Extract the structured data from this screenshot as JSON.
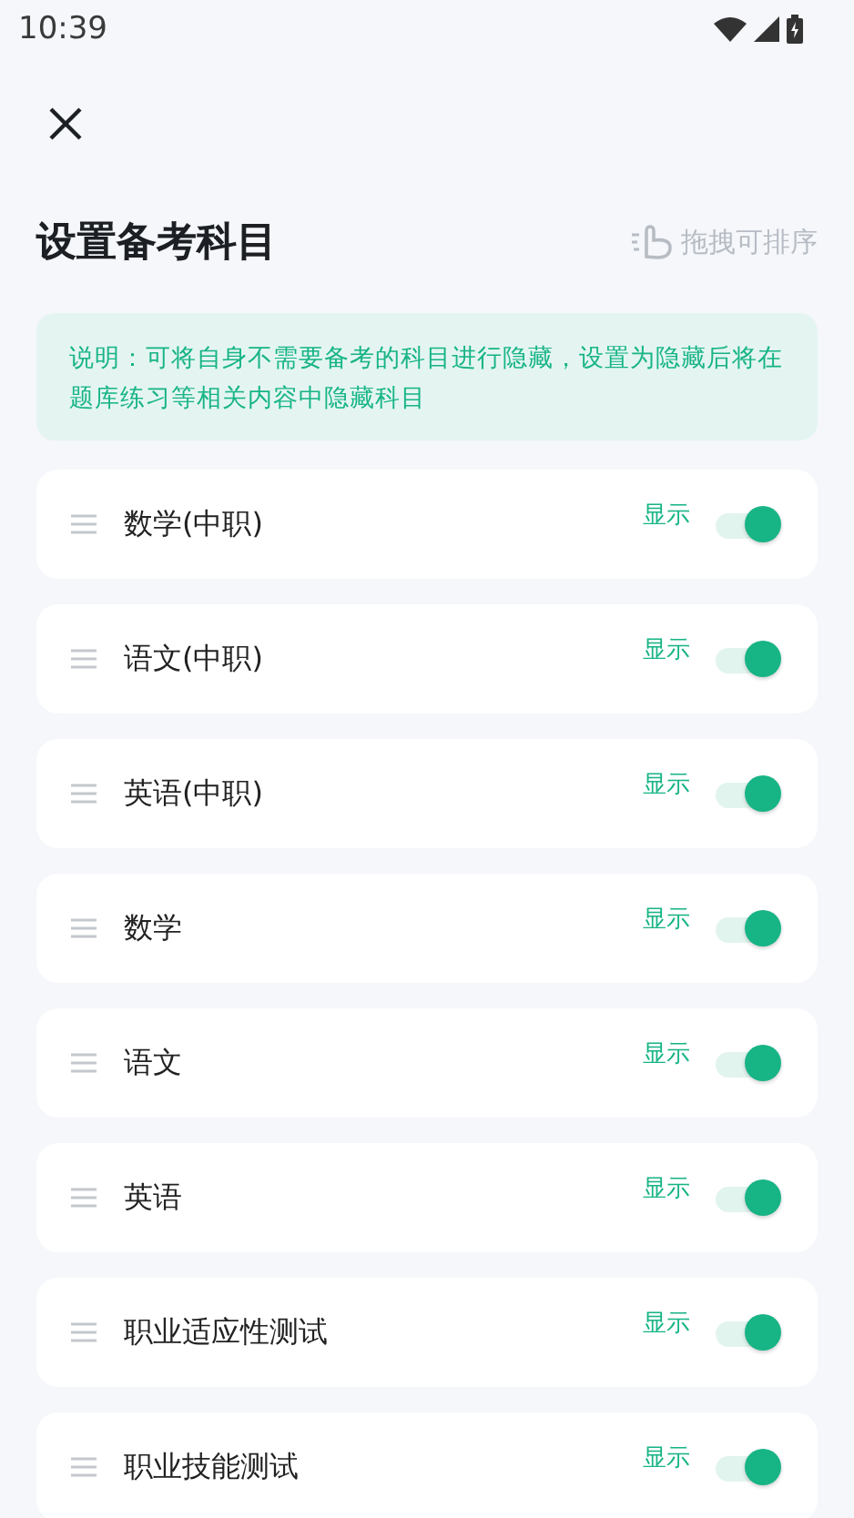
{
  "status_bar": {
    "time": "10:39"
  },
  "header": {
    "title": "设置备考科目",
    "drag_hint": "拖拽可排序"
  },
  "notice": "说明：可将自身不需要备考的科目进行隐藏，设置为隐藏后将在题库练习等相关内容中隐藏科目",
  "subjects": [
    {
      "name": "数学(中职)",
      "state_label": "显示",
      "on": true
    },
    {
      "name": "语文(中职)",
      "state_label": "显示",
      "on": true
    },
    {
      "name": "英语(中职)",
      "state_label": "显示",
      "on": true
    },
    {
      "name": "数学",
      "state_label": "显示",
      "on": true
    },
    {
      "name": "语文",
      "state_label": "显示",
      "on": true
    },
    {
      "name": "英语",
      "state_label": "显示",
      "on": true
    },
    {
      "name": "职业适应性测试",
      "state_label": "显示",
      "on": true
    },
    {
      "name": "职业技能测试",
      "state_label": "显示",
      "on": true
    }
  ]
}
